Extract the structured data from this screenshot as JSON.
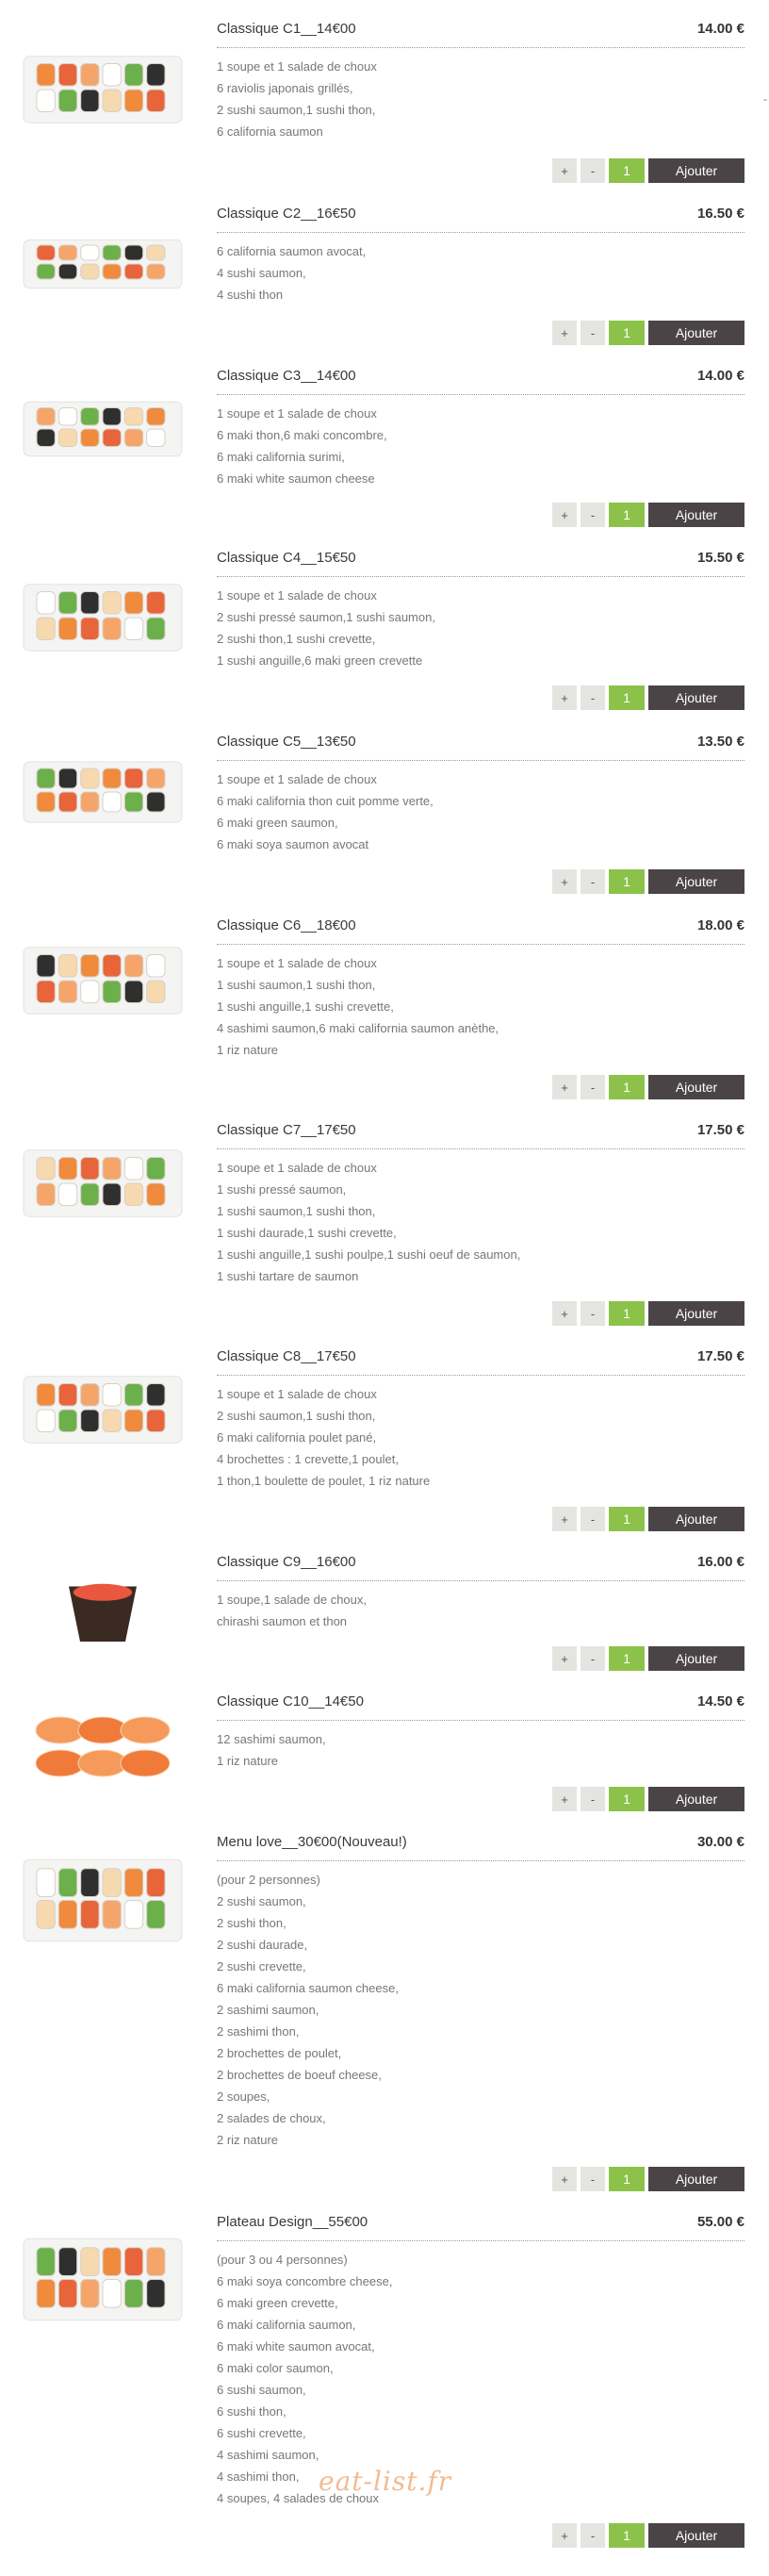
{
  "buttons": {
    "plus": "+",
    "minus": "-",
    "add": "Ajouter"
  },
  "watermark": "eat-list.fr",
  "colors": {
    "quantity": "#8dc24a",
    "add_button": "#4a4446",
    "stepper": "#e4e4e0"
  },
  "items": [
    {
      "title": "Classique C1__14€00",
      "price": "14.00 €",
      "qty": "1",
      "image": "sushi-plate-image",
      "lines": [
        "1 soupe et 1 salade de choux",
        "6 raviolis japonais grillés,",
        "2 sushi saumon,1 sushi thon,",
        "6 california saumon"
      ]
    },
    {
      "title": "Classique C2__16€50",
      "price": "16.50 €",
      "qty": "1",
      "image": "sushi-plate-image",
      "lines": [
        "6 california saumon avocat,",
        "4 sushi saumon,",
        "4 sushi thon"
      ]
    },
    {
      "title": "Classique C3__14€00",
      "price": "14.00 €",
      "qty": "1",
      "image": "sushi-plate-image",
      "lines": [
        "1 soupe et 1 salade de choux",
        "6 maki thon,6 maki concombre,",
        "6 maki california surimi,",
        "6 maki white saumon cheese"
      ]
    },
    {
      "title": "Classique C4__15€50",
      "price": "15.50 €",
      "qty": "1",
      "image": "sushi-plate-image",
      "lines": [
        "1 soupe et 1 salade de choux",
        "2 sushi pressé saumon,1 sushi saumon,",
        "2 sushi thon,1 sushi crevette,",
        "1 sushi anguille,6 maki green crevette"
      ]
    },
    {
      "title": "Classique C5__13€50",
      "price": "13.50 €",
      "qty": "1",
      "image": "sushi-plate-image",
      "lines": [
        "1 soupe et 1 salade de choux",
        "6 maki california thon cuit pomme verte,",
        "6 maki green saumon,",
        "6 maki soya saumon avocat"
      ]
    },
    {
      "title": "Classique C6__18€00",
      "price": "18.00 €",
      "qty": "1",
      "image": "sushi-plate-image",
      "lines": [
        "1 soupe et 1 salade de choux",
        "1 sushi saumon,1 sushi thon,",
        "1 sushi anguille,1 sushi crevette,",
        "4 sashimi saumon,6 maki california saumon anèthe,",
        "1 riz nature"
      ]
    },
    {
      "title": "Classique C7__17€50",
      "price": "17.50 €",
      "qty": "1",
      "image": "sushi-plate-image",
      "lines": [
        "1 soupe et 1 salade de choux",
        "1 sushi pressé saumon,",
        "1 sushi saumon,1 sushi thon,",
        "1 sushi daurade,1 sushi crevette,",
        "1 sushi anguille,1 sushi poulpe,1 sushi oeuf de saumon,",
        "1 sushi tartare de saumon"
      ]
    },
    {
      "title": "Classique C8__17€50",
      "price": "17.50 €",
      "qty": "1",
      "image": "sushi-plate-image",
      "lines": [
        "1 soupe et 1 salade de choux",
        "2 sushi saumon,1 sushi thon,",
        "6 maki california poulet pané,",
        "4 brochettes : 1 crevette,1 poulet,",
        "1 thon,1 boulette de poulet, 1 riz nature"
      ]
    },
    {
      "title": "Classique C9__16€00",
      "price": "16.00 €",
      "qty": "1",
      "image": "chirashi-bowl-image",
      "lines": [
        "1 soupe,1 salade de choux,",
        "chirashi saumon et thon"
      ]
    },
    {
      "title": "Classique C10__14€50",
      "price": "14.50 €",
      "qty": "1",
      "image": "sashimi-image",
      "lines": [
        "12 sashimi saumon,",
        "1 riz nature"
      ]
    },
    {
      "title": "Menu love__30€00(Nouveau!)",
      "price": "30.00 €",
      "qty": "1",
      "image": "sushi-plate-image",
      "lines": [
        "(pour 2 personnes)",
        "2 sushi saumon,",
        "2 sushi thon,",
        "2 sushi daurade,",
        "2 sushi crevette,",
        "6 maki california saumon cheese,",
        "2 sashimi saumon,",
        "2 sashimi thon,",
        "2 brochettes de poulet,",
        "2 brochettes de boeuf cheese,",
        "2 soupes,",
        "2 salades de choux,",
        "2 riz nature"
      ]
    },
    {
      "title": "Plateau Design__55€00",
      "price": "55.00 €",
      "qty": "1",
      "image": "sushi-plate-image",
      "lines": [
        "(pour 3 ou 4 personnes)",
        "6 maki soya concombre cheese,",
        "6 maki green crevette,",
        "6 maki california saumon,",
        "6 maki white saumon avocat,",
        "6 maki color saumon,",
        "6 sushi saumon,",
        "6 sushi thon,",
        "6 sushi crevette,",
        "4 sashimi saumon,",
        "4 sashimi thon,",
        "4 soupes, 4 salades de choux"
      ]
    }
  ]
}
